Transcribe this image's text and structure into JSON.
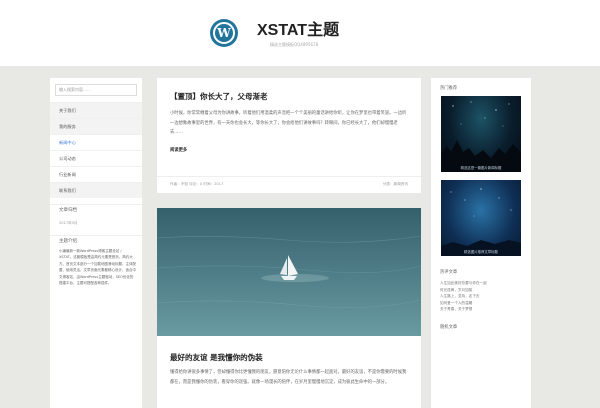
{
  "header": {
    "site_title": "XSTAT主题",
    "site_subtitle": "精选主题模板QQ4895678",
    "logo_letter": "W"
  },
  "left": {
    "search_placeholder": "输入搜索内容……",
    "menu": [
      {
        "label": "关于我们"
      },
      {
        "label": "我的服务"
      },
      {
        "label": "新闻中心"
      },
      {
        "label": "公司动态"
      },
      {
        "label": "行业新闻"
      },
      {
        "label": "联系我们"
      }
    ],
    "archive_title": "文章归档",
    "archive_items": [
      "2017年5月"
    ],
    "intro_title": "主题介绍",
    "intro_text": "小编最新一款WordPress博客主题全站 / XSTAT。这套模板是由简约元素是首页，简约大方。首页文本部分一个加载地图滑动标题，主体配置，使用灵活，文章页面元素都精心设计。适合中文博客站，由WordPress主题驱动，SEO优化的搭建平台，主题可搭配各种插件。"
  },
  "posts": [
    {
      "title": "【置顶】你长大了，父母渐老",
      "excerpt": "小时候，你常常缠着父母为你讲故事，听着他们用温柔的声音把一个个美丽的童话讲给你听，让你在梦里也带着笑容。一边听一边想象故事里的世界，有一天你也会长大，等你长大了，你会给他们讲故事吗？转眼间，你已经长大了，他们却慢慢老去……",
      "read_more": "阅读更多",
      "meta": "作者：不知  评论：0  时间：2017",
      "category": "分类：新闻资讯"
    },
    {
      "title": "最好的友谊 是我懂你的伪装",
      "excerpt": "懂得给你讲很多事情了，但却懂得你比更懂我的朋友，愿意陪你无论什么事情都一起面对。最好的友谊，不是你需要的时候我都在，而是我懂你的伪装，看穿你的逞强。就像一场漫长的陪伴，在岁月里慢慢地沉淀，成为彼此生命中的一部分。"
    }
  ],
  "right": {
    "popular_title": "热门推荐",
    "thumb_captions": [
      "精选这是一篇图片新闻标题",
      "精选图片推荐文章标题"
    ],
    "recent_title": "热评文章",
    "recent_items": [
      "人生如此美好总要与你在一起",
      "时光荏苒，岁月如梭",
      "人生路上，坚持，走下去",
      "如何爱一个人的温暖",
      "关于青春，关于梦想"
    ],
    "tags_title": "随机文章"
  }
}
